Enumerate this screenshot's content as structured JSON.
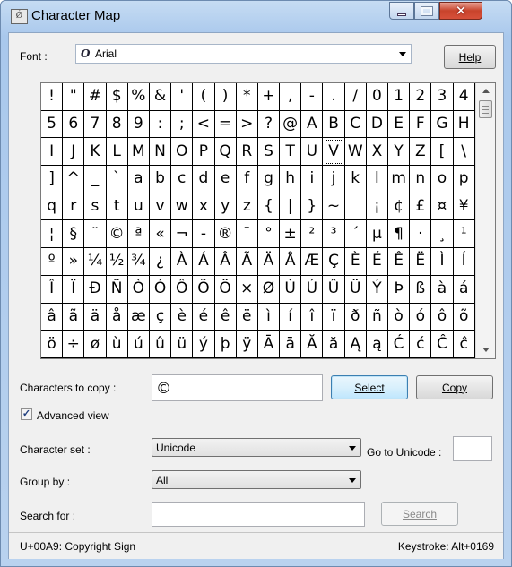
{
  "window": {
    "title": "Character Map"
  },
  "labels": {
    "font": "Font :",
    "help": "Help",
    "characters_to_copy": "Characters to copy :",
    "select": "Select",
    "copy": "Copy",
    "advanced_view": "Advanced view",
    "character_set": "Character set :",
    "go_to_unicode": "Go to Unicode :",
    "group_by": "Group by :",
    "search_for": "Search for :",
    "search": "Search"
  },
  "font": {
    "value": "Arial",
    "icon": "opentype-font-icon"
  },
  "characters_to_copy_value": "©",
  "advanced_view_checked": true,
  "character_set": "Unicode",
  "group_by": "All",
  "go_to_unicode_value": "",
  "search_value": "",
  "selected_index": 53,
  "characters": [
    "!",
    "\"",
    "#",
    "$",
    "%",
    "&",
    "'",
    "(",
    ")",
    "*",
    "+",
    ",",
    "-",
    ".",
    "/",
    "0",
    "1",
    "2",
    "3",
    "4",
    "5",
    "6",
    "7",
    "8",
    "9",
    ":",
    ";",
    "<",
    "=",
    ">",
    "?",
    "@",
    "A",
    "B",
    "C",
    "D",
    "E",
    "F",
    "G",
    "H",
    "I",
    "J",
    "K",
    "L",
    "M",
    "N",
    "O",
    "P",
    "Q",
    "R",
    "S",
    "T",
    "U",
    "V",
    "W",
    "X",
    "Y",
    "Z",
    "[",
    "\\",
    "]",
    "^",
    "_",
    "`",
    "a",
    "b",
    "c",
    "d",
    "e",
    "f",
    "g",
    "h",
    "i",
    "j",
    "k",
    "l",
    "m",
    "n",
    "o",
    "p",
    "q",
    "r",
    "s",
    "t",
    "u",
    "v",
    "w",
    "x",
    "y",
    "z",
    "{",
    "|",
    "}",
    "~",
    " ",
    "¡",
    "¢",
    "£",
    "¤",
    "¥",
    "¦",
    "§",
    "¨",
    "©",
    "ª",
    "«",
    "¬",
    "-",
    "®",
    "¯",
    "°",
    "±",
    "²",
    "³",
    "´",
    "µ",
    "¶",
    "·",
    "¸",
    "¹",
    "º",
    "»",
    "¼",
    "½",
    "¾",
    "¿",
    "À",
    "Á",
    "Â",
    "Ã",
    "Ä",
    "Å",
    "Æ",
    "Ç",
    "È",
    "É",
    "Ê",
    "Ë",
    "Ì",
    "Í",
    "Î",
    "Ï",
    "Ð",
    "Ñ",
    "Ò",
    "Ó",
    "Ô",
    "Õ",
    "Ö",
    "×",
    "Ø",
    "Ù",
    "Ú",
    "Û",
    "Ü",
    "Ý",
    "Þ",
    "ß",
    "à",
    "á",
    "â",
    "ã",
    "ä",
    "å",
    "æ",
    "ç",
    "è",
    "é",
    "ê",
    "ë",
    "ì",
    "í",
    "î",
    "ï",
    "ð",
    "ñ",
    "ò",
    "ó",
    "ô",
    "õ",
    "ö",
    "÷",
    "ø",
    "ù",
    "ú",
    "û",
    "ü",
    "ý",
    "þ",
    "ÿ",
    "Ā",
    "ā",
    "Ă",
    "ă",
    "Ą",
    "ą",
    "Ć",
    "ć",
    "Ĉ",
    "ĉ"
  ],
  "status": {
    "character_info": "U+00A9: Copyright Sign",
    "keystroke": "Keystroke: Alt+0169"
  }
}
